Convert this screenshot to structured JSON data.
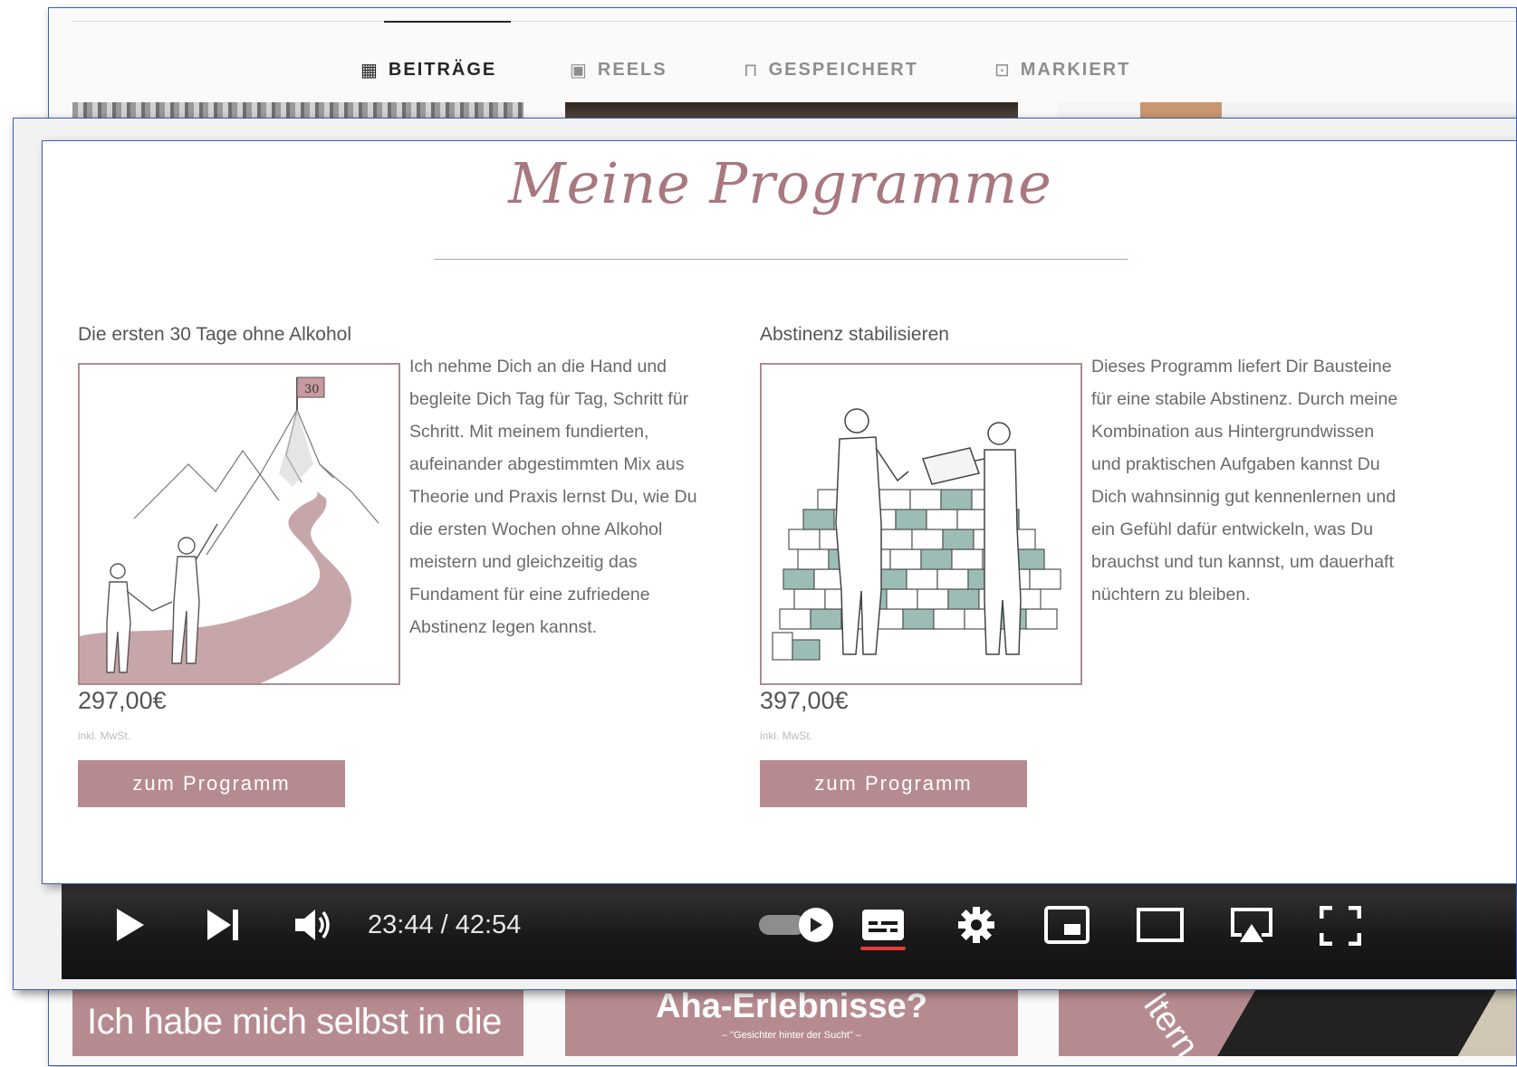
{
  "instagram": {
    "tabs": [
      {
        "label": "BEITRÄGE",
        "icon": "grid-icon",
        "active": true
      },
      {
        "label": "REELS",
        "icon": "reels-icon",
        "active": false
      },
      {
        "label": "GESPEICHERT",
        "icon": "bookmark-icon",
        "active": false
      },
      {
        "label": "MARKIERT",
        "icon": "tagged-icon",
        "active": false
      }
    ],
    "tiles": [
      {
        "text": "Ich habe mich selbst in die"
      },
      {
        "text": "Aha-Erlebnisse?",
        "subtext": "– \"Gesichter hinter der Sucht\" –"
      },
      {
        "text": "ltern"
      }
    ]
  },
  "video": {
    "time": "23:44 / 42:54",
    "controls": [
      "play-icon",
      "next-icon",
      "volume-icon",
      "autoplay-toggle",
      "subtitles-icon",
      "settings-icon",
      "miniplayer-icon",
      "theater-icon",
      "cast-icon",
      "fullscreen-icon"
    ]
  },
  "programmes": {
    "heading": "Meine Programme",
    "items": [
      {
        "title": "Die ersten 30 Tage ohne Alkohol",
        "description": "Ich nehme Dich an die Hand und begleite Dich Tag für Tag, Schritt für Schritt. Mit meinem fundierten, aufeinander abgestimmten Mix aus Theorie und Praxis lernst Du, wie Du die ersten Wochen ohne Alkohol meistern und gleichzeitig das Fundament für eine zufriedene Abstinenz legen kannst.",
        "price": "297,00€",
        "tax": "inkl. MwSt.",
        "button": "zum Programm",
        "flag_text": "30"
      },
      {
        "title": "Abstinenz stabilisieren",
        "description": "Dieses Programm liefert Dir Bausteine für eine stabile Abstinenz. Durch meine Kombination aus Hintergrundwissen und praktischen Aufgaben kannst Du Dich wahnsinnig gut kennenlernen und ein Gefühl dafür entwickeln, was Du brauchst und tun kannst, um dauerhaft nüchtern zu bleiben.",
        "price": "397,00€",
        "tax": "inkl. MwSt.",
        "button": "zum Programm"
      }
    ]
  },
  "colors": {
    "accent": "#b68b90",
    "heading": "#a8787e",
    "frame_border": "#3c5fb8"
  }
}
